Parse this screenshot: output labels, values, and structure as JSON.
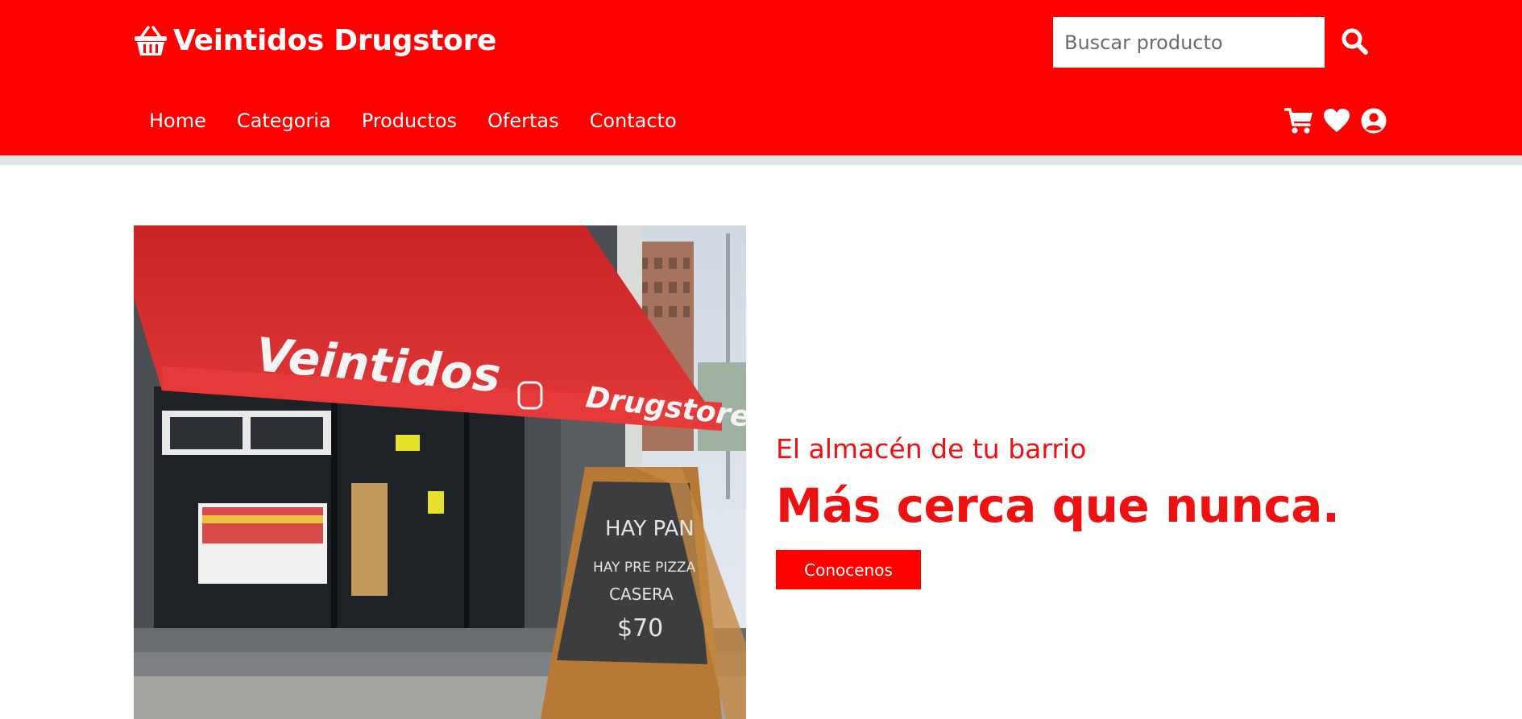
{
  "header": {
    "brand_name": "Veintidos Drugstore",
    "brand_icon": "shopping-basket-icon",
    "search": {
      "placeholder": "Buscar producto",
      "value": "",
      "icon": "search-icon"
    },
    "nav": [
      {
        "label": "Home"
      },
      {
        "label": "Categoria"
      },
      {
        "label": "Productos"
      },
      {
        "label": "Ofertas"
      },
      {
        "label": "Contacto"
      }
    ],
    "icons": [
      "shopping-cart-icon",
      "heart-icon",
      "user-circle-icon"
    ]
  },
  "hero": {
    "subtitle": "El almacén de tu barrio",
    "title": "Más cerca que nunca.",
    "button_label": "Conocenos",
    "photo": {
      "awning_text_left": "Veintidos",
      "awning_text_right": "Drugstore",
      "chalkboard_lines": [
        "HAY PAN",
        "HAY PRE PIZZA",
        "CASERA",
        "$70"
      ]
    }
  },
  "colors": {
    "brand_red": "#ff0000",
    "hero_text": "#ee1111",
    "divider": "#e5e5e5",
    "header_text": "#ffffff"
  }
}
